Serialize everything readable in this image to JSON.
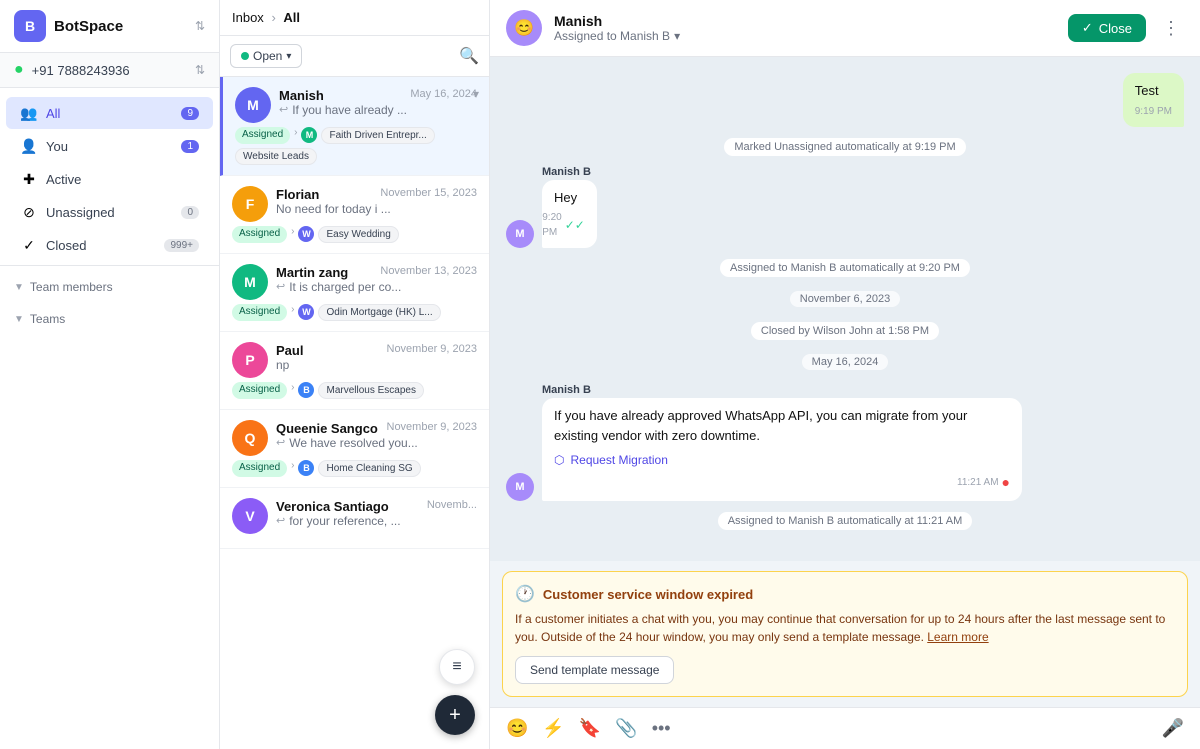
{
  "sidebar": {
    "logo": "B",
    "brand": "BotSpace",
    "phone": "+91 7888243936",
    "nav": [
      {
        "id": "all",
        "label": "All",
        "badge": "9",
        "badge_type": "purple",
        "active": true,
        "icon": "👥"
      },
      {
        "id": "you",
        "label": "You",
        "badge": "1",
        "badge_type": "purple",
        "active": false,
        "icon": "👤"
      },
      {
        "id": "active",
        "label": "Active",
        "badge": "",
        "badge_type": "",
        "active": false,
        "icon": "➕"
      },
      {
        "id": "unassigned",
        "label": "Unassigned",
        "badge": "0",
        "badge_type": "gray",
        "active": false,
        "icon": "🚫"
      },
      {
        "id": "closed",
        "label": "Closed",
        "badge": "999+",
        "badge_type": "gray",
        "active": false,
        "icon": "✓"
      }
    ],
    "team_members_label": "Team members",
    "teams_label": "Teams"
  },
  "inbox": {
    "breadcrumb_inbox": "Inbox",
    "breadcrumb_all": "All",
    "filter_label": "Open",
    "items": [
      {
        "id": "manish",
        "name": "Manish",
        "time": "May 16, 2024",
        "preview": "If you have already ...",
        "avatar_letter": "M",
        "avatar_color": "#6366f1",
        "tags": [
          "Assigned",
          "Website Leads",
          "Faith Driven Entrepr..."
        ],
        "agent_color": "#10b981",
        "agent_letter": "M",
        "selected": true
      },
      {
        "id": "florian",
        "name": "Florian",
        "time": "November 15, 2023",
        "preview": "No need for today i ...",
        "avatar_letter": "F",
        "avatar_color": "#f59e0b",
        "tags": [
          "Assigned",
          "Easy Wedding"
        ],
        "agent_color": "#6366f1",
        "agent_letter": "W",
        "selected": false
      },
      {
        "id": "martin",
        "name": "Martin zang",
        "time": "November 13, 2023",
        "preview": "It is charged per co...",
        "avatar_letter": "M",
        "avatar_color": "#10b981",
        "tags": [
          "Assigned",
          "Odin Mortgage (HK) L..."
        ],
        "agent_color": "#6366f1",
        "agent_letter": "W",
        "selected": false
      },
      {
        "id": "paul",
        "name": "Paul",
        "time": "November 9, 2023",
        "preview": "np",
        "avatar_letter": "P",
        "avatar_color": "#ec4899",
        "tags": [
          "Assigned",
          "Marvellous Escapes"
        ],
        "agent_color": "#3b82f6",
        "agent_letter": "B",
        "selected": false
      },
      {
        "id": "queenie",
        "name": "Queenie Sangco",
        "time": "November 9, 2023",
        "preview": "We have resolved you...",
        "avatar_letter": "Q",
        "avatar_color": "#f97316",
        "tags": [
          "Assigned",
          "Home Cleaning SG"
        ],
        "agent_color": "#3b82f6",
        "agent_letter": "B",
        "selected": false
      },
      {
        "id": "veronica",
        "name": "Veronica Santiago",
        "time": "Novemb...",
        "preview": "for your reference, ...",
        "avatar_letter": "V",
        "avatar_color": "#8b5cf6",
        "tags": [],
        "selected": false
      }
    ]
  },
  "chat": {
    "contact_name": "Manish",
    "assigned_to": "Assigned to Manish B",
    "close_label": "Close",
    "messages": [
      {
        "id": "m1",
        "type": "outgoing",
        "sender": "",
        "text": "Test",
        "time": "9:19 PM",
        "check": ""
      },
      {
        "id": "s1",
        "type": "system",
        "text": "Marked Unassigned automatically at 9:19 PM"
      },
      {
        "id": "m2",
        "type": "incoming",
        "sender": "Manish B",
        "text": "Hey",
        "time": "9:20 PM",
        "check": "✓✓"
      },
      {
        "id": "s2",
        "type": "system",
        "text": "Assigned to Manish B automatically at 9:20 PM"
      },
      {
        "id": "d1",
        "type": "date",
        "text": "November 6, 2023"
      },
      {
        "id": "s3",
        "type": "system",
        "text": "Closed by Wilson John at 1:58 PM"
      },
      {
        "id": "d2",
        "type": "date",
        "text": "May 16, 2024"
      },
      {
        "id": "m3",
        "type": "incoming",
        "sender": "Manish B",
        "text": "If you have already approved WhatsApp API, you can migrate from your existing vendor with zero downtime.",
        "time": "11:21 AM",
        "link": "Request Migration",
        "has_error": true
      },
      {
        "id": "s4",
        "type": "system",
        "text": "Assigned to Manish B automatically at 11:21 AM"
      }
    ],
    "warning": {
      "title": "Customer service window expired",
      "text": "If a customer initiates a chat with you, you may continue that conversation for up to 24 hours after the last message sent to you. Outside of the 24 hour window, you may only send a template message.",
      "learn_more": "Learn more",
      "send_template_label": "Send template message"
    },
    "input_icons": [
      "😊",
      "⚡",
      "🔖",
      "📎",
      "•••"
    ]
  }
}
